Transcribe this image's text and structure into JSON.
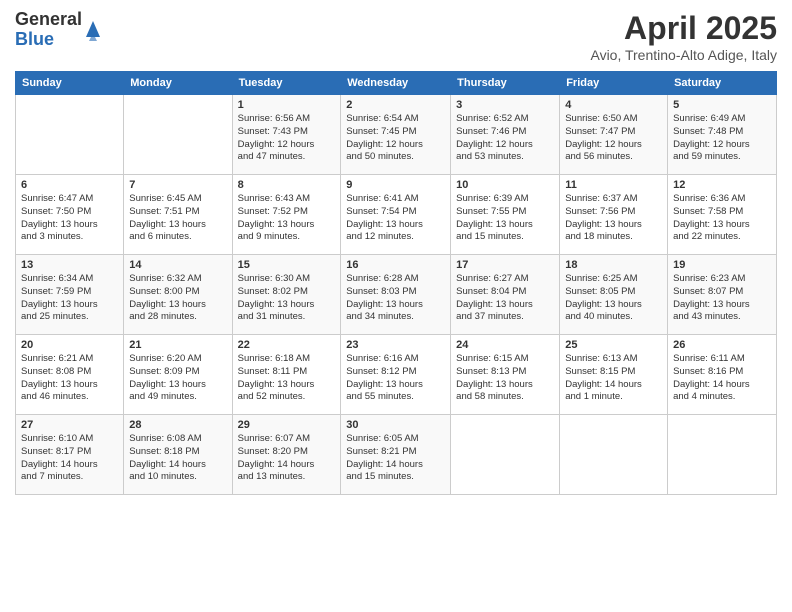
{
  "logo": {
    "general": "General",
    "blue": "Blue"
  },
  "title": "April 2025",
  "subtitle": "Avio, Trentino-Alto Adige, Italy",
  "days_header": [
    "Sunday",
    "Monday",
    "Tuesday",
    "Wednesday",
    "Thursday",
    "Friday",
    "Saturday"
  ],
  "weeks": [
    [
      {
        "day": "",
        "info": ""
      },
      {
        "day": "",
        "info": ""
      },
      {
        "day": "1",
        "info": "Sunrise: 6:56 AM\nSunset: 7:43 PM\nDaylight: 12 hours\nand 47 minutes."
      },
      {
        "day": "2",
        "info": "Sunrise: 6:54 AM\nSunset: 7:45 PM\nDaylight: 12 hours\nand 50 minutes."
      },
      {
        "day": "3",
        "info": "Sunrise: 6:52 AM\nSunset: 7:46 PM\nDaylight: 12 hours\nand 53 minutes."
      },
      {
        "day": "4",
        "info": "Sunrise: 6:50 AM\nSunset: 7:47 PM\nDaylight: 12 hours\nand 56 minutes."
      },
      {
        "day": "5",
        "info": "Sunrise: 6:49 AM\nSunset: 7:48 PM\nDaylight: 12 hours\nand 59 minutes."
      }
    ],
    [
      {
        "day": "6",
        "info": "Sunrise: 6:47 AM\nSunset: 7:50 PM\nDaylight: 13 hours\nand 3 minutes."
      },
      {
        "day": "7",
        "info": "Sunrise: 6:45 AM\nSunset: 7:51 PM\nDaylight: 13 hours\nand 6 minutes."
      },
      {
        "day": "8",
        "info": "Sunrise: 6:43 AM\nSunset: 7:52 PM\nDaylight: 13 hours\nand 9 minutes."
      },
      {
        "day": "9",
        "info": "Sunrise: 6:41 AM\nSunset: 7:54 PM\nDaylight: 13 hours\nand 12 minutes."
      },
      {
        "day": "10",
        "info": "Sunrise: 6:39 AM\nSunset: 7:55 PM\nDaylight: 13 hours\nand 15 minutes."
      },
      {
        "day": "11",
        "info": "Sunrise: 6:37 AM\nSunset: 7:56 PM\nDaylight: 13 hours\nand 18 minutes."
      },
      {
        "day": "12",
        "info": "Sunrise: 6:36 AM\nSunset: 7:58 PM\nDaylight: 13 hours\nand 22 minutes."
      }
    ],
    [
      {
        "day": "13",
        "info": "Sunrise: 6:34 AM\nSunset: 7:59 PM\nDaylight: 13 hours\nand 25 minutes."
      },
      {
        "day": "14",
        "info": "Sunrise: 6:32 AM\nSunset: 8:00 PM\nDaylight: 13 hours\nand 28 minutes."
      },
      {
        "day": "15",
        "info": "Sunrise: 6:30 AM\nSunset: 8:02 PM\nDaylight: 13 hours\nand 31 minutes."
      },
      {
        "day": "16",
        "info": "Sunrise: 6:28 AM\nSunset: 8:03 PM\nDaylight: 13 hours\nand 34 minutes."
      },
      {
        "day": "17",
        "info": "Sunrise: 6:27 AM\nSunset: 8:04 PM\nDaylight: 13 hours\nand 37 minutes."
      },
      {
        "day": "18",
        "info": "Sunrise: 6:25 AM\nSunset: 8:05 PM\nDaylight: 13 hours\nand 40 minutes."
      },
      {
        "day": "19",
        "info": "Sunrise: 6:23 AM\nSunset: 8:07 PM\nDaylight: 13 hours\nand 43 minutes."
      }
    ],
    [
      {
        "day": "20",
        "info": "Sunrise: 6:21 AM\nSunset: 8:08 PM\nDaylight: 13 hours\nand 46 minutes."
      },
      {
        "day": "21",
        "info": "Sunrise: 6:20 AM\nSunset: 8:09 PM\nDaylight: 13 hours\nand 49 minutes."
      },
      {
        "day": "22",
        "info": "Sunrise: 6:18 AM\nSunset: 8:11 PM\nDaylight: 13 hours\nand 52 minutes."
      },
      {
        "day": "23",
        "info": "Sunrise: 6:16 AM\nSunset: 8:12 PM\nDaylight: 13 hours\nand 55 minutes."
      },
      {
        "day": "24",
        "info": "Sunrise: 6:15 AM\nSunset: 8:13 PM\nDaylight: 13 hours\nand 58 minutes."
      },
      {
        "day": "25",
        "info": "Sunrise: 6:13 AM\nSunset: 8:15 PM\nDaylight: 14 hours\nand 1 minute."
      },
      {
        "day": "26",
        "info": "Sunrise: 6:11 AM\nSunset: 8:16 PM\nDaylight: 14 hours\nand 4 minutes."
      }
    ],
    [
      {
        "day": "27",
        "info": "Sunrise: 6:10 AM\nSunset: 8:17 PM\nDaylight: 14 hours\nand 7 minutes."
      },
      {
        "day": "28",
        "info": "Sunrise: 6:08 AM\nSunset: 8:18 PM\nDaylight: 14 hours\nand 10 minutes."
      },
      {
        "day": "29",
        "info": "Sunrise: 6:07 AM\nSunset: 8:20 PM\nDaylight: 14 hours\nand 13 minutes."
      },
      {
        "day": "30",
        "info": "Sunrise: 6:05 AM\nSunset: 8:21 PM\nDaylight: 14 hours\nand 15 minutes."
      },
      {
        "day": "",
        "info": ""
      },
      {
        "day": "",
        "info": ""
      },
      {
        "day": "",
        "info": ""
      }
    ]
  ]
}
